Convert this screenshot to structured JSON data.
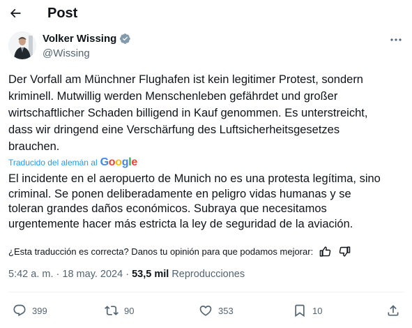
{
  "header": {
    "title": "Post",
    "back_icon": "arrow-left-icon"
  },
  "author": {
    "name": "Volker Wissing",
    "handle": "@Wissing",
    "verified_badge": "verified-badge-icon",
    "badge_color": "#829aab"
  },
  "post": {
    "text": "Der Vorfall am Münchner Flughafen ist kein legitimer Protest, sondern\nkriminell. Mutwillig werden Menschenleben gefährdet und großer\nwirtschaftlicher Schaden billigend in Kauf genommen. Es unterstreicht,\ndass wir dringend eine Verschärfung des Luftsicherheitsgesetzes\nbrauchen.",
    "translated_label": "Traducido del alemán al",
    "translator_logo": "Google",
    "translation": "El incidente en el aeropuerto de Munich no es una protesta legítima, sino\ncriminal. Se ponen deliberadamente en peligro vidas humanas y se\ntoleran grandes daños económicos. Subraya que necesitamos\nurgentemente hacer más estricta la ley de seguridad de la aviación.",
    "feedback_question": "¿Esta traducción es correcta? Danos tu opinión para que podamos mejorar:",
    "time": "5:42 a. m.",
    "separator": "·",
    "date": "18 may. 2024",
    "views_count": "53,5 mil",
    "views_label": "Reproducciones"
  },
  "actions": {
    "replies": "399",
    "reposts": "90",
    "likes": "353",
    "bookmarks": "10"
  },
  "colors": {
    "accent": "#1d9bf0",
    "muted": "#536471",
    "text": "#0f1419"
  }
}
